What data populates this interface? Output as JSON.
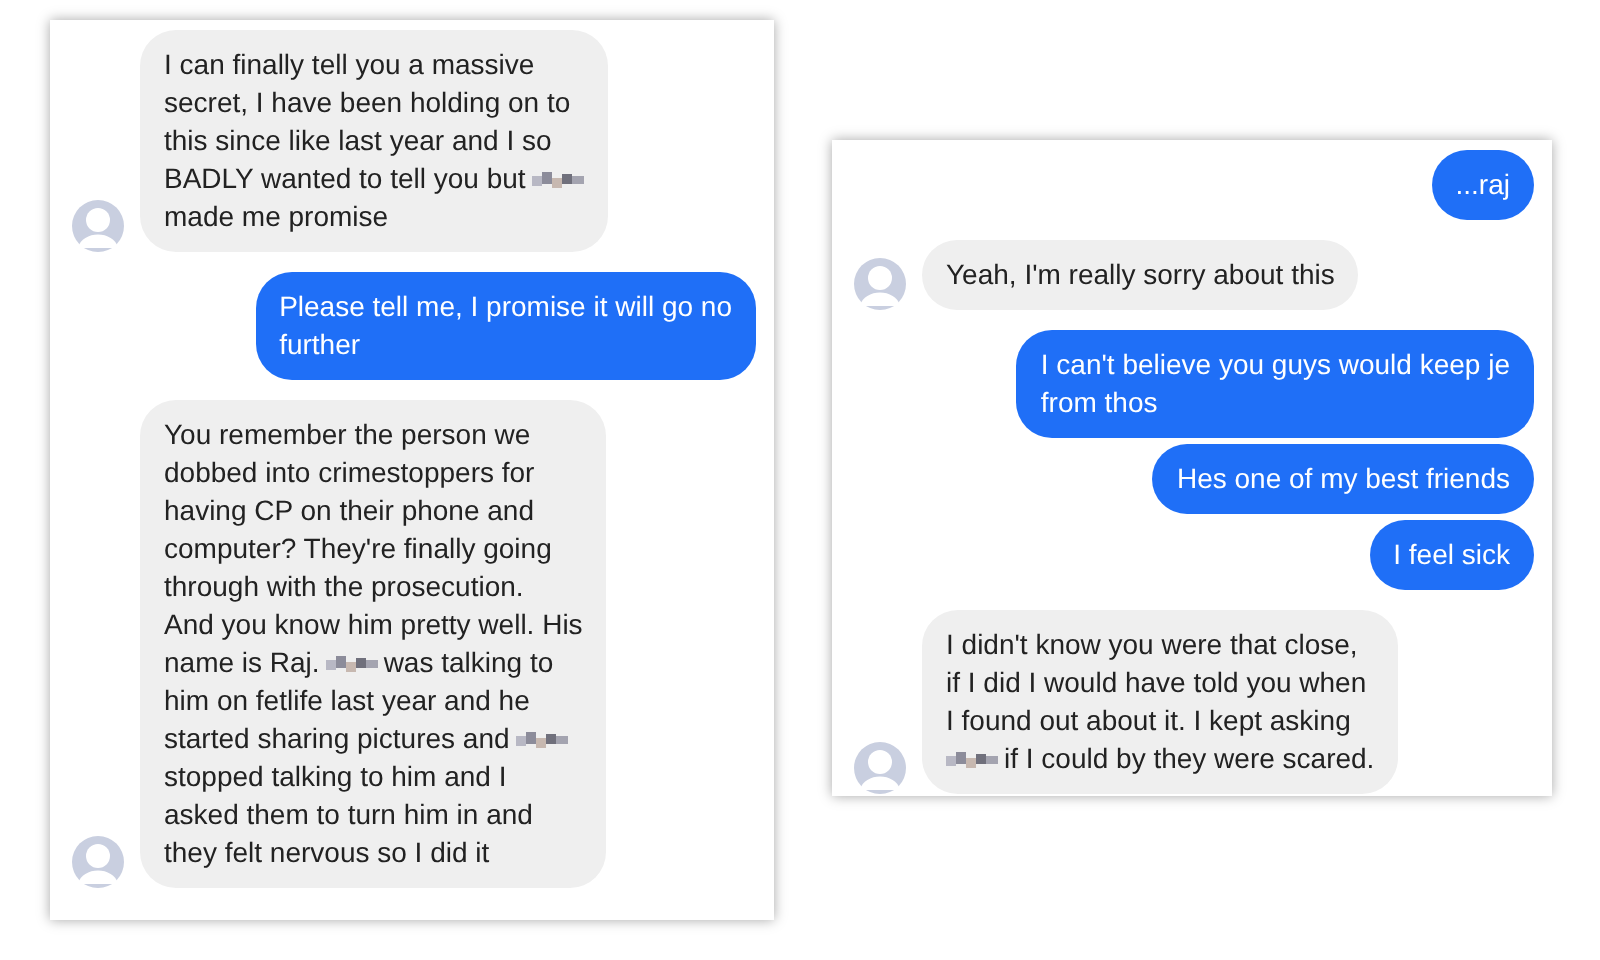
{
  "conversations": [
    {
      "messages": [
        {
          "kind": "incoming",
          "lines": [
            [
              {
                "kind": "text",
                "text": "I can finally tell you a massive"
              }
            ],
            [
              {
                "kind": "text",
                "text": "secret, I have been holding on to"
              }
            ],
            [
              {
                "kind": "text",
                "text": "this since like last year and I so"
              }
            ],
            [
              {
                "kind": "text",
                "text": "BADLY wanted to tell you but"
              },
              {
                "kind": "redacted"
              }
            ],
            [
              {
                "kind": "text",
                "text": "made me promise"
              }
            ]
          ]
        },
        {
          "kind": "outgoing",
          "lines": [
            [
              {
                "kind": "text",
                "text": "Please tell me, I promise it will go no"
              }
            ],
            [
              {
                "kind": "text",
                "text": "further"
              }
            ]
          ]
        },
        {
          "kind": "incoming",
          "lines": [
            [
              {
                "kind": "text",
                "text": "You remember the person we"
              }
            ],
            [
              {
                "kind": "text",
                "text": "dobbed into crimestoppers for"
              }
            ],
            [
              {
                "kind": "text",
                "text": "having CP on their phone and"
              }
            ],
            [
              {
                "kind": "text",
                "text": "computer? They're finally going"
              }
            ],
            [
              {
                "kind": "text",
                "text": "through with the prosecution."
              }
            ],
            [
              {
                "kind": "text",
                "text": "And you know him pretty well. His"
              }
            ],
            [
              {
                "kind": "text",
                "text": "name is Raj."
              },
              {
                "kind": "redacted"
              },
              {
                "kind": "text",
                "text": "was talking to"
              }
            ],
            [
              {
                "kind": "text",
                "text": "him on fetlife last year and he"
              }
            ],
            [
              {
                "kind": "text",
                "text": "started sharing pictures and"
              },
              {
                "kind": "redacted"
              }
            ],
            [
              {
                "kind": "text",
                "text": "stopped talking to him and I"
              }
            ],
            [
              {
                "kind": "text",
                "text": "asked them to turn him in and"
              }
            ],
            [
              {
                "kind": "text",
                "text": "they felt nervous so I did it"
              }
            ]
          ]
        }
      ]
    },
    {
      "messages": [
        {
          "kind": "outgoing",
          "lines": [
            [
              {
                "kind": "text",
                "text": "...raj"
              }
            ]
          ]
        },
        {
          "kind": "incoming",
          "lines": [
            [
              {
                "kind": "text",
                "text": "Yeah, I'm really sorry about this"
              }
            ]
          ]
        },
        {
          "kind": "outgoing",
          "lines": [
            [
              {
                "kind": "text",
                "text": "I can't believe you guys would keep je"
              }
            ],
            [
              {
                "kind": "text",
                "text": "from thos"
              }
            ]
          ]
        },
        {
          "kind": "outgoing",
          "lines": [
            [
              {
                "kind": "text",
                "text": "Hes one of my best friends"
              }
            ]
          ]
        },
        {
          "kind": "outgoing",
          "lines": [
            [
              {
                "kind": "text",
                "text": "I feel sick"
              }
            ]
          ]
        },
        {
          "kind": "incoming",
          "lines": [
            [
              {
                "kind": "text",
                "text": "I didn't know you were that close,"
              }
            ],
            [
              {
                "kind": "text",
                "text": "if I did I would have told you when"
              }
            ],
            [
              {
                "kind": "text",
                "text": "I found out about it. I kept asking"
              }
            ],
            [
              {
                "kind": "redacted"
              },
              {
                "kind": "text",
                "text": "if I could by they were scared."
              }
            ]
          ]
        }
      ]
    }
  ]
}
